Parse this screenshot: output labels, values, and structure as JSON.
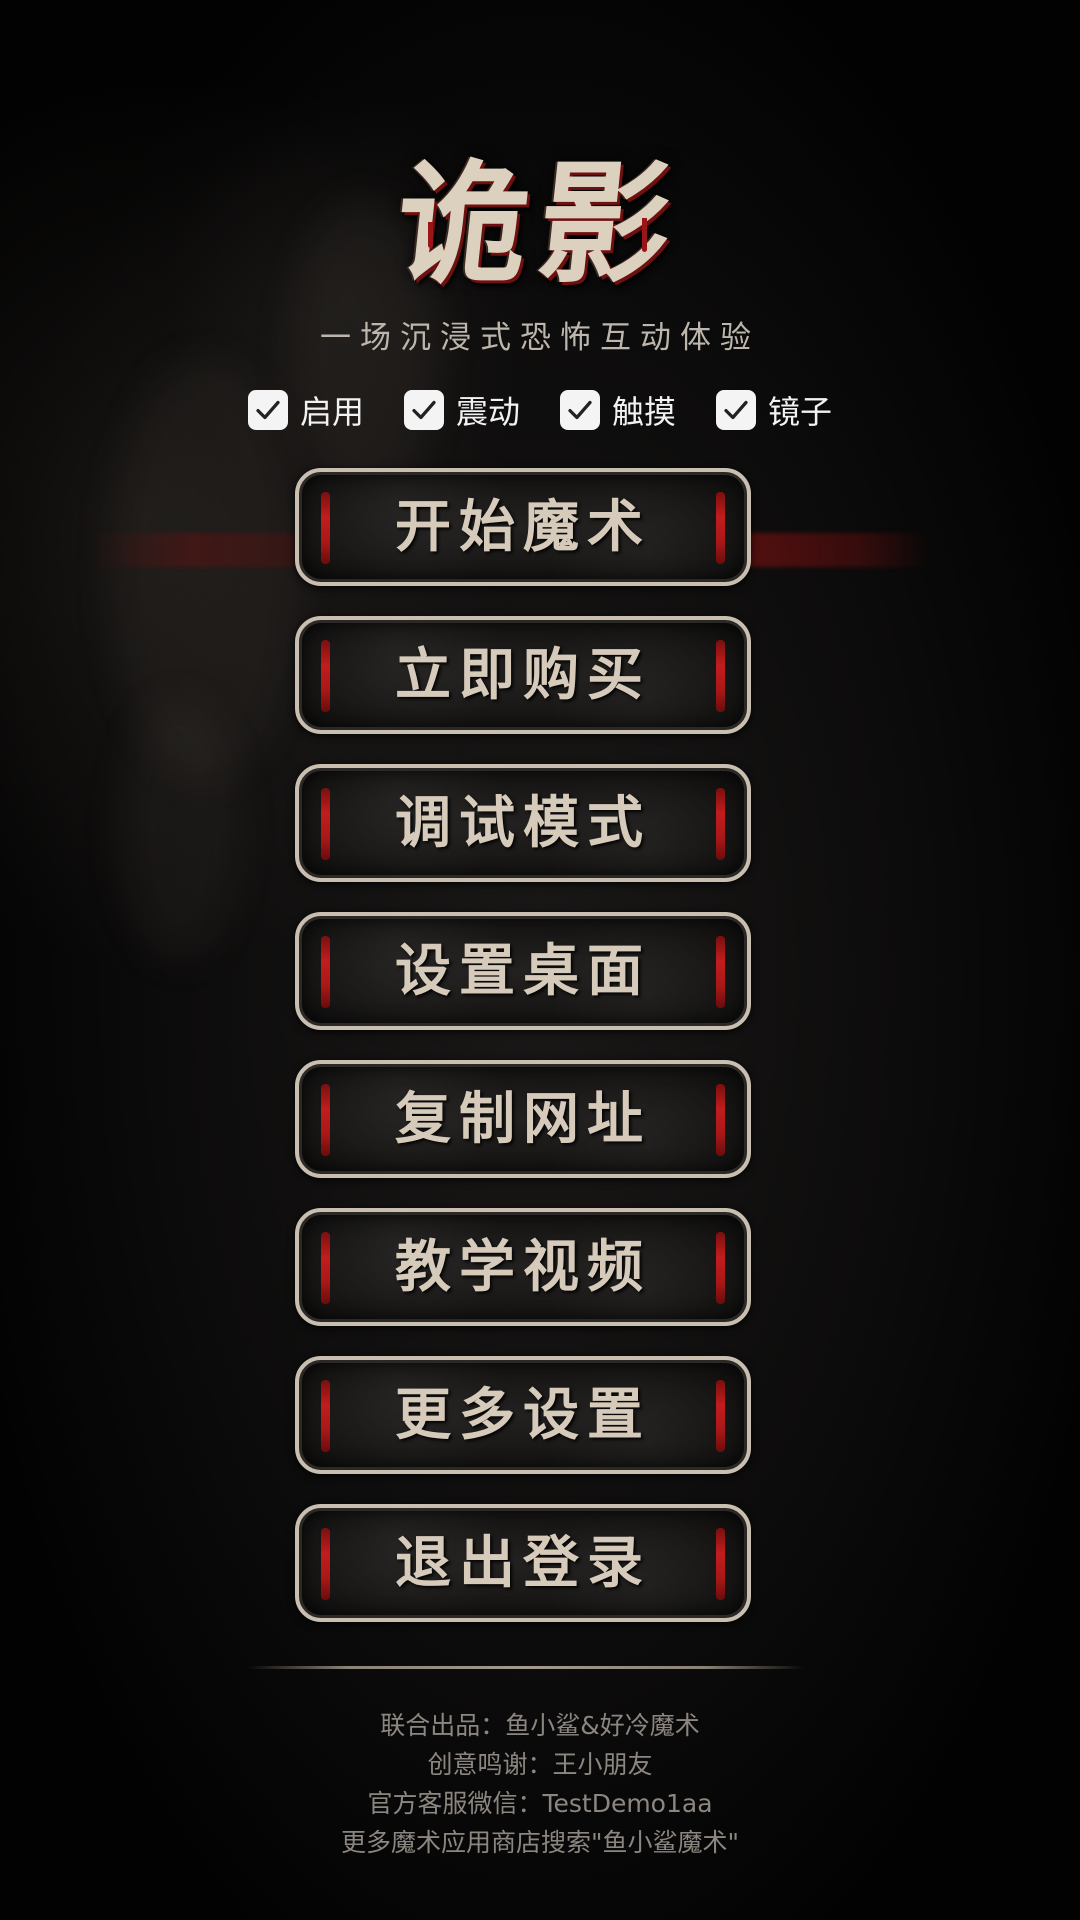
{
  "app": {
    "title": "诡影",
    "subtitle": "一场沉浸式恐怖互动体验"
  },
  "options": [
    {
      "label": "启用",
      "checked": true,
      "icon": "check-icon"
    },
    {
      "label": "震动",
      "checked": true,
      "icon": "check-icon"
    },
    {
      "label": "触摸",
      "checked": true,
      "icon": "check-icon"
    },
    {
      "label": "镜子",
      "checked": true,
      "icon": "check-icon"
    }
  ],
  "menu": [
    {
      "label": "开始魔术"
    },
    {
      "label": "立即购买"
    },
    {
      "label": "调试模式"
    },
    {
      "label": "设置桌面"
    },
    {
      "label": "复制网址"
    },
    {
      "label": "教学视频"
    },
    {
      "label": "更多设置"
    },
    {
      "label": "退出登录"
    }
  ],
  "credits": [
    "联合出品：鱼小鲨&好冷魔术",
    "创意鸣谢：王小朋友",
    "官方客服微信：TestDemo1aa",
    "更多魔术应用商店搜索\"鱼小鲨魔术\""
  ],
  "colors": {
    "background": "#000000",
    "button_border": "#c9bfb1",
    "button_text": "#d6cabb",
    "blood_mark": "#c11d1d",
    "title": "#dcd0bf",
    "credits_text": "#8c8680"
  }
}
